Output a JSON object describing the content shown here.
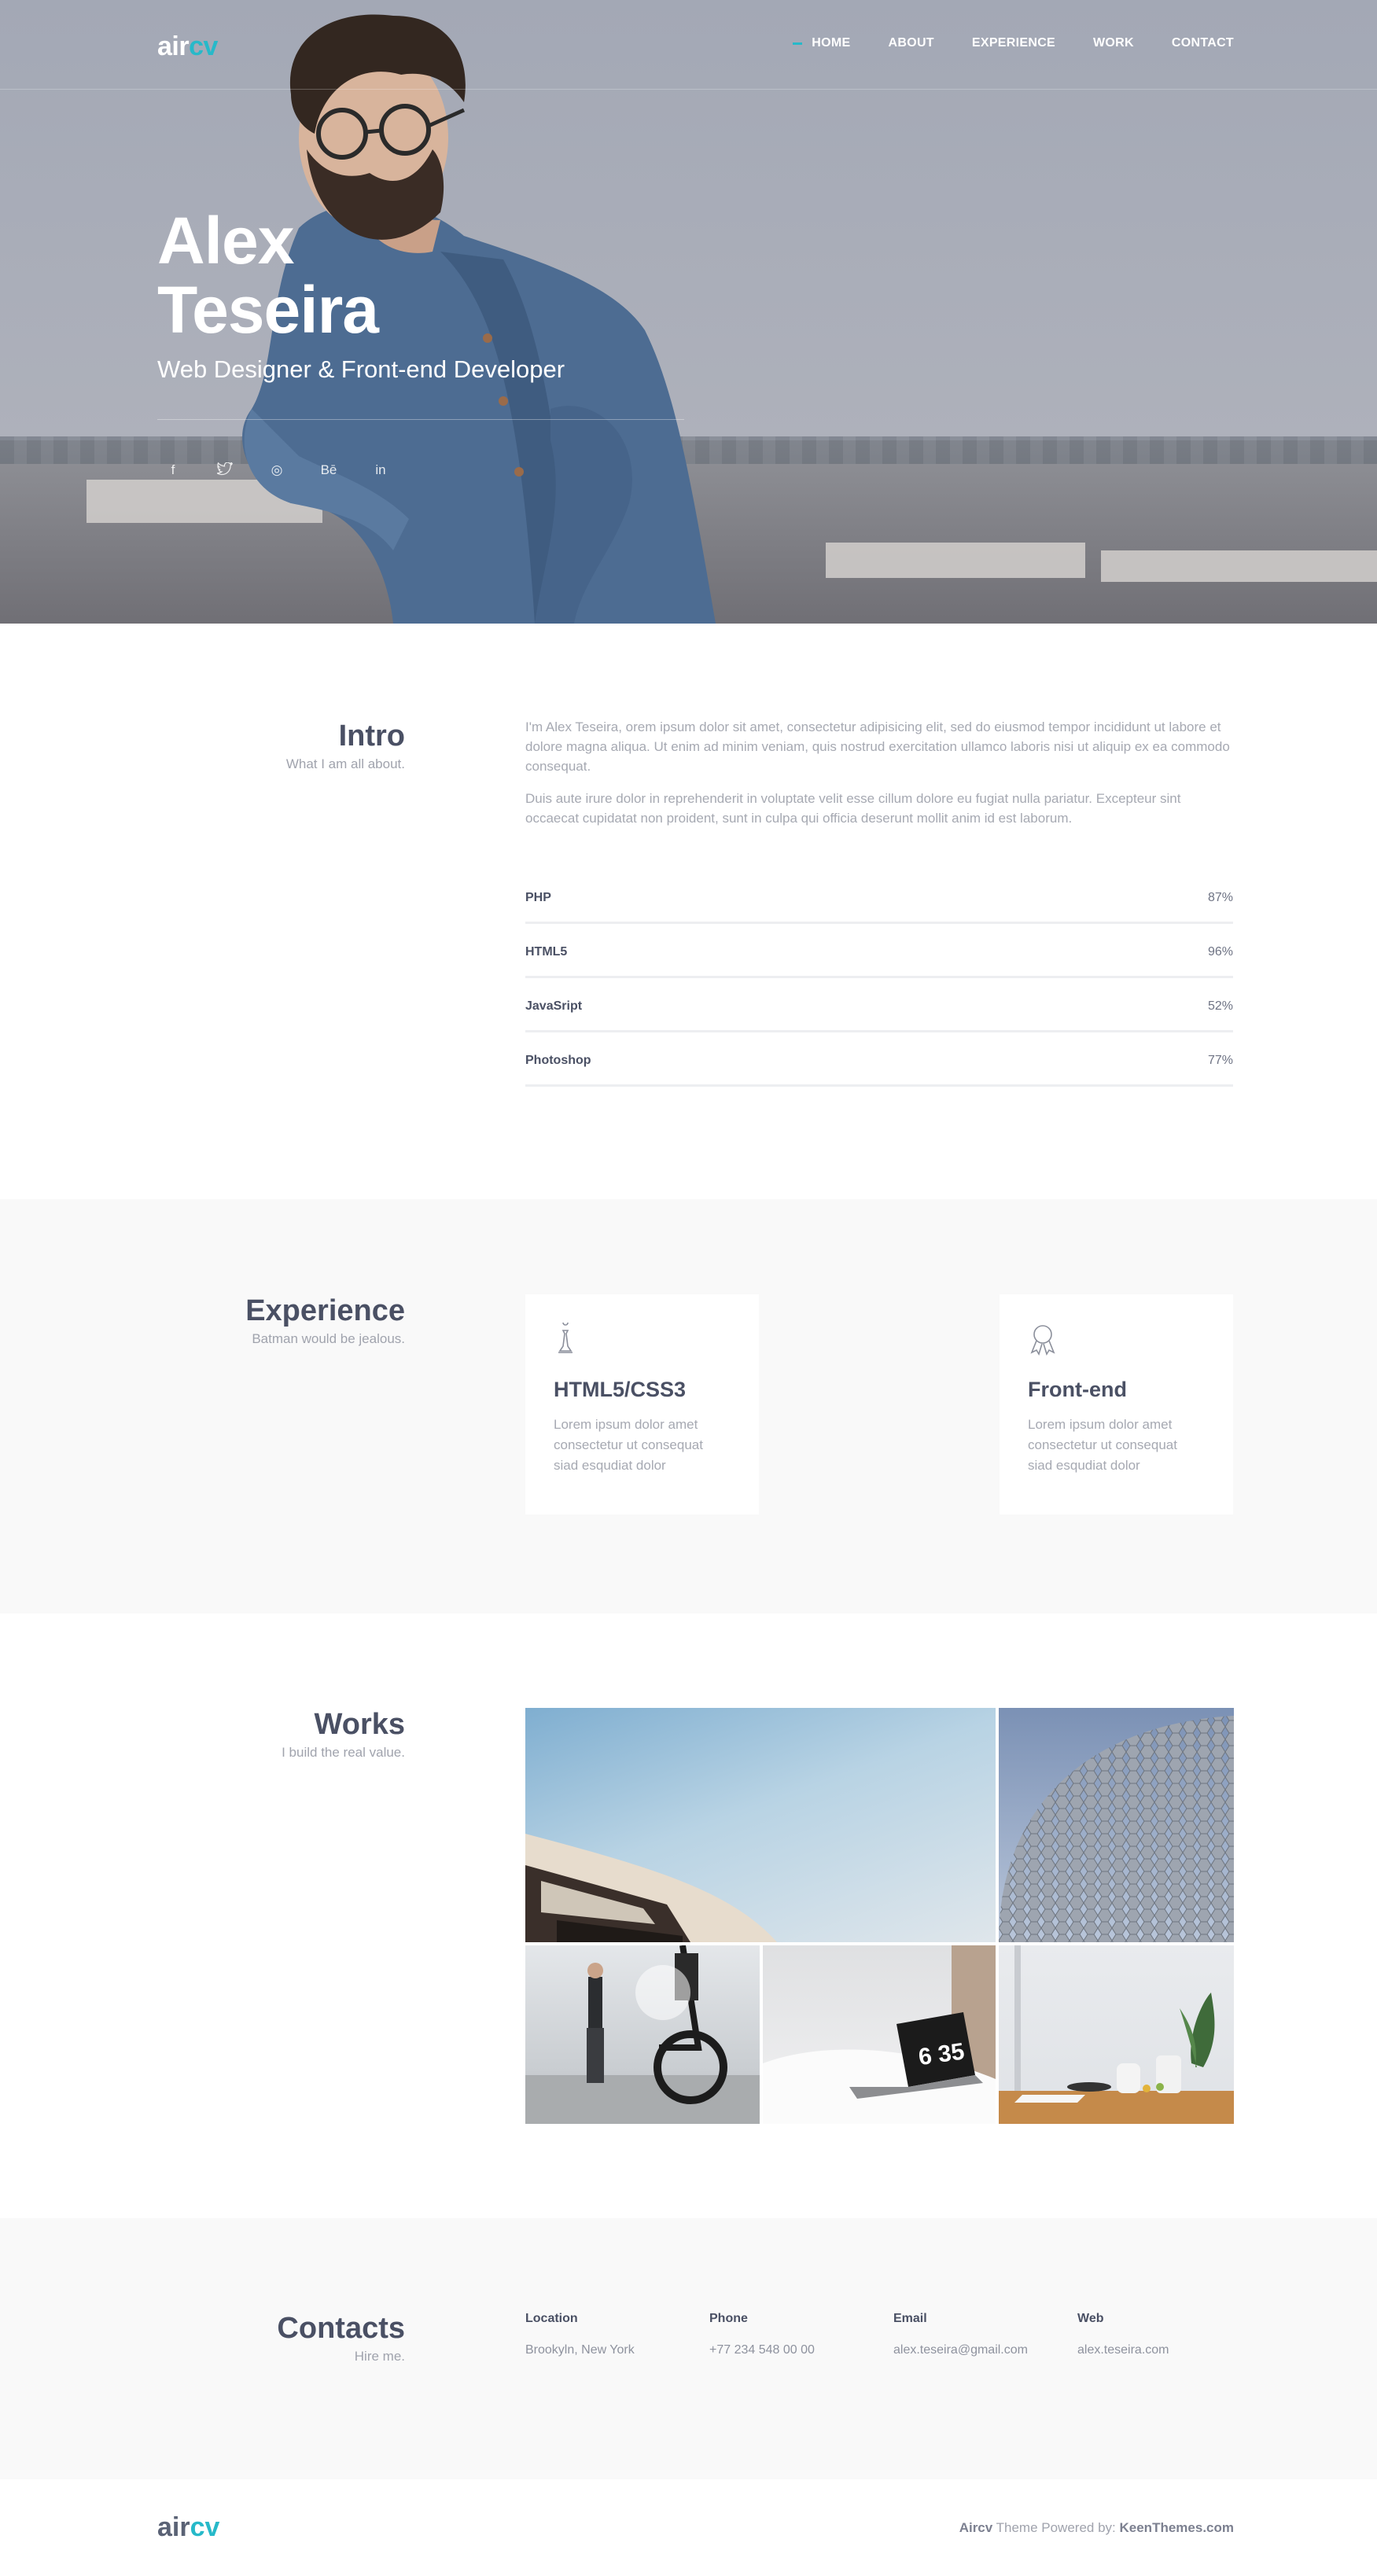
{
  "logo": {
    "part1": "air",
    "part2": "cv"
  },
  "nav": [
    {
      "label": "HOME",
      "active": true
    },
    {
      "label": "ABOUT"
    },
    {
      "label": "EXPERIENCE"
    },
    {
      "label": "WORK"
    },
    {
      "label": "CONTACT"
    }
  ],
  "hero": {
    "first_name": "Alex",
    "last_name": "Teseira",
    "subtitle": "Web Designer & Front-end Developer",
    "socials": [
      {
        "icon": "facebook-icon",
        "glyph": "f"
      },
      {
        "icon": "twitter-icon",
        "glyph": "🐦"
      },
      {
        "icon": "dribbble-icon",
        "glyph": "◎"
      },
      {
        "icon": "behance-icon",
        "glyph": "Bē"
      },
      {
        "icon": "linkedin-icon",
        "glyph": "in"
      }
    ]
  },
  "intro": {
    "title": "Intro",
    "subtitle": "What I am all about.",
    "paragraph1": "I'm Alex Teseira, orem ipsum dolor sit amet, consectetur adipisicing elit, sed do eiusmod tempor incididunt ut labore et dolore magna aliqua. Ut enim ad minim veniam, quis nostrud exercitation ullamco laboris nisi ut aliquip ex ea commodo consequat.",
    "paragraph2": "Duis aute irure dolor in reprehenderit in voluptate velit esse cillum dolore eu fugiat nulla pariatur. Excepteur sint occaecat cupidatat non proident, sunt in culpa qui officia deserunt mollit anim id est laborum.",
    "skills": [
      {
        "name": "PHP",
        "value": "87%"
      },
      {
        "name": "HTML5",
        "value": "96%"
      },
      {
        "name": "JavaSript",
        "value": "52%"
      },
      {
        "name": "Photoshop",
        "value": "77%"
      }
    ]
  },
  "experience": {
    "title": "Experience",
    "subtitle": "Batman would be jealous.",
    "cards": [
      {
        "icon": "chess-piece-icon",
        "glyph": "♝",
        "title": "HTML5/CSS3",
        "text": "Lorem ipsum dolor amet consectetur ut consequat siad esqudiat dolor"
      },
      {
        "icon": "award-ribbon-icon",
        "glyph": "🎖",
        "title": "Front-end",
        "text": "Lorem ipsum dolor amet consectetur ut consequat siad esqudiat dolor"
      }
    ]
  },
  "works": {
    "title": "Works",
    "subtitle": "I build the real value."
  },
  "contacts": {
    "title": "Contacts",
    "subtitle": "Hire me.",
    "items": [
      {
        "label": "Location",
        "value": "Brookyln, New York"
      },
      {
        "label": "Phone",
        "value": "+77 234 548 00 00"
      },
      {
        "label": "Email",
        "value": "alex.teseira@gmail.com"
      },
      {
        "label": "Web",
        "value": "alex.teseira.com"
      }
    ]
  },
  "footer": {
    "brand": "Aircv",
    "middle": " Theme Powered by: ",
    "powered": "KeenThemes.com"
  },
  "colors": {
    "accent": "#27b9c9",
    "heading": "#4a5064",
    "muted": "#a6a9b2"
  }
}
